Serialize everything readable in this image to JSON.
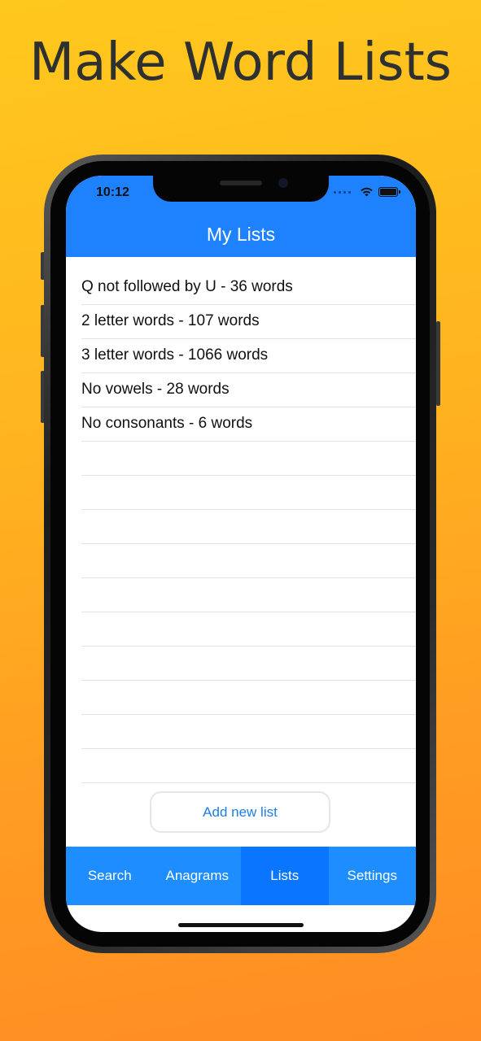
{
  "headline": "Make Word Lists",
  "status_bar": {
    "time": "10:12",
    "icons": [
      "signal-dots-icon",
      "wifi-icon",
      "battery-icon"
    ]
  },
  "nav": {
    "title": "My Lists"
  },
  "lists": [
    {
      "label": "Q not followed by U - 36 words"
    },
    {
      "label": "2 letter words - 107 words"
    },
    {
      "label": "3 letter words - 1066 words"
    },
    {
      "label": "No vowels - 28 words"
    },
    {
      "label": "No consonants - 6 words"
    }
  ],
  "add_button": {
    "label": "Add new list"
  },
  "tabs": [
    {
      "label": "Search"
    },
    {
      "label": "Anagrams"
    },
    {
      "label": "Lists",
      "active": true
    },
    {
      "label": "Settings"
    }
  ],
  "colors": {
    "accent": "#1e82ff",
    "background_top": "#ffc81d",
    "background_bottom": "#ff8c24",
    "link": "#1e7ee3"
  }
}
